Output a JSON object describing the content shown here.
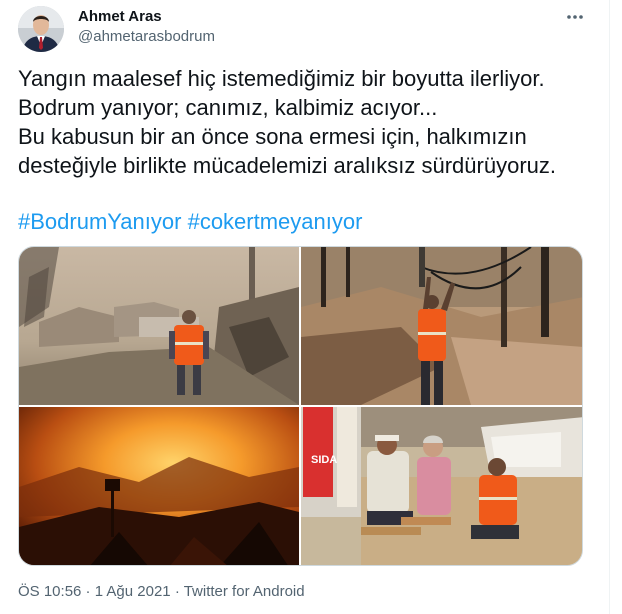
{
  "author": {
    "name": "Ahmet Aras",
    "handle": "@ahmetarasbodrum"
  },
  "tweet": {
    "lines": [
      "Yangın maalesef hiç istemediğimiz bir boyutta ilerliyor.",
      "Bodrum yanıyor; canımız, kalbimiz acıyor...",
      "Bu kabusun bir an önce sona ermesi için, halkımızın",
      "desteğiyle birlikte mücadelemizi aralıksız sürdürüyoruz."
    ],
    "hashtags": [
      "#BodrumYanıyor",
      "#cokertmeyanıyor"
    ]
  },
  "media": {
    "photo4_sign_text": "SIDA"
  },
  "meta": {
    "time": "ÖS 10:56",
    "separator": " · ",
    "date": "1 Ağu 2021",
    "source": "Twitter for Android"
  },
  "icons": {
    "more": "more-dots-icon"
  },
  "colors": {
    "link": "#1d9bf0",
    "secondary_text": "#536471",
    "vest_orange": "#f05a1a"
  }
}
